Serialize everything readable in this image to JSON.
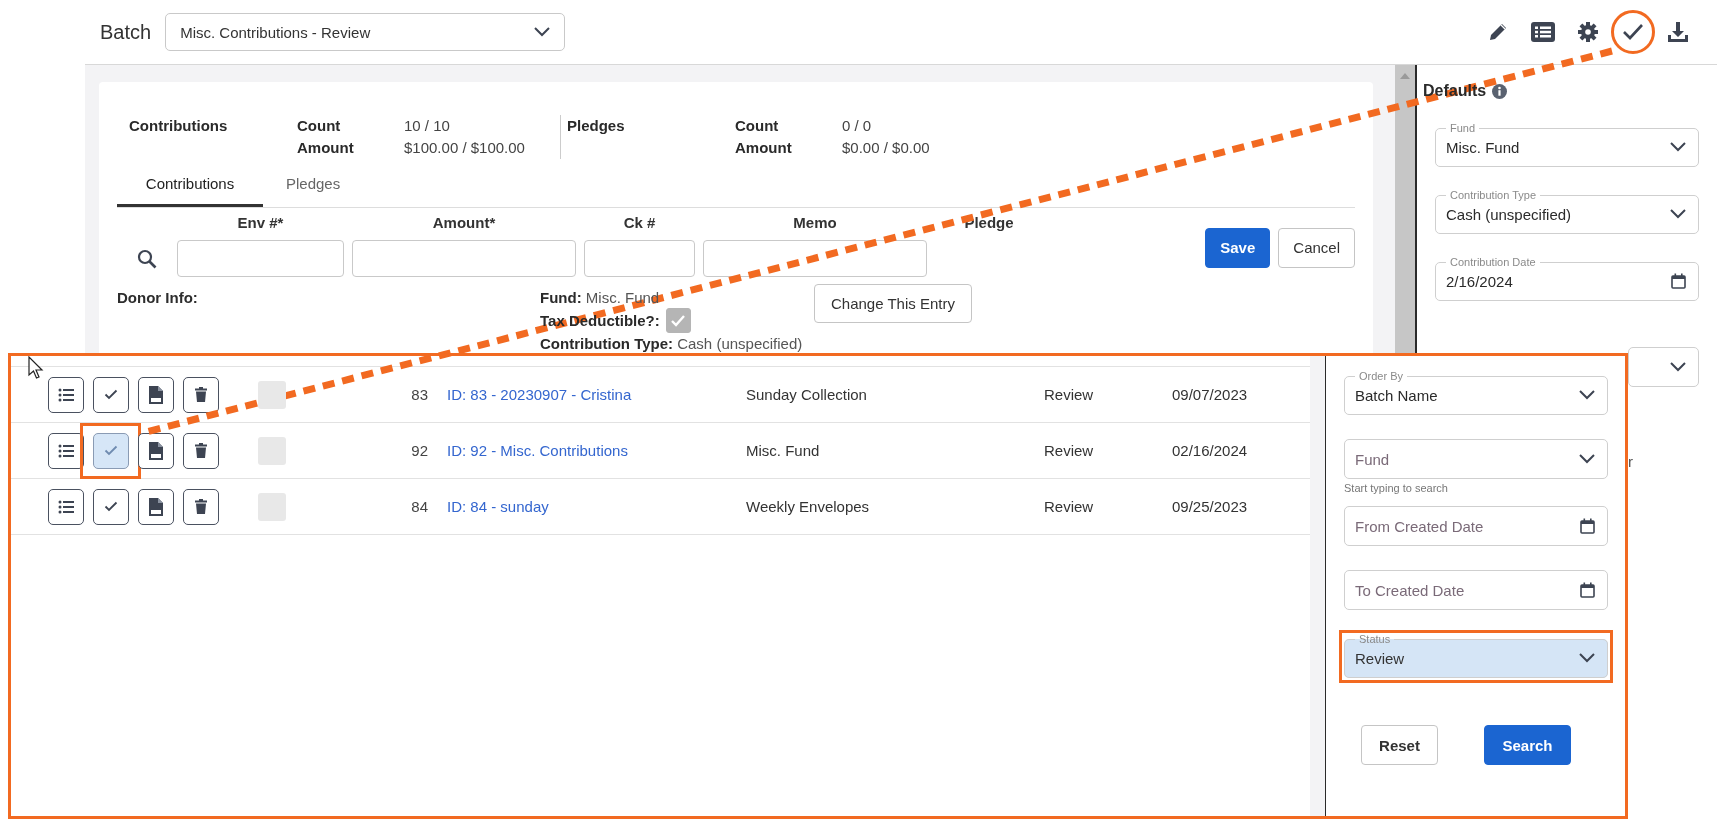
{
  "header": {
    "title": "Batch",
    "batch_select": "Misc. Contributions - Review",
    "toolbar": [
      {
        "kind": "edit",
        "annotated": false
      },
      {
        "kind": "list",
        "annotated": false
      },
      {
        "kind": "settings",
        "annotated": false
      },
      {
        "kind": "approve",
        "annotated": true
      },
      {
        "kind": "download",
        "annotated": false
      }
    ]
  },
  "summary": [
    {
      "label": "Contributions",
      "count_label": "Count",
      "count": "10 / 10",
      "amount_label": "Amount",
      "amount": "$100.00 / $100.00"
    },
    {
      "label": "Pledges",
      "count_label": "Count",
      "count": "0 / 0",
      "amount_label": "Amount",
      "amount": "$0.00 / $0.00"
    }
  ],
  "tabs": [
    {
      "label": "Contributions",
      "selected": true
    },
    {
      "label": "Pledges",
      "selected": false
    }
  ],
  "entry_form": {
    "columns": [
      "Env #*",
      "Amount*",
      "Ck #",
      "Memo",
      "Pledge"
    ],
    "save": "Save",
    "cancel": "Cancel",
    "donor_info": "Donor Info:",
    "fund": {
      "label": "Fund:",
      "value": "Misc. Fund"
    },
    "tax_deductible": {
      "label": "Tax Deductible?:",
      "checked": true
    },
    "contribution_type": {
      "label": "Contribution Type:",
      "value": "Cash (unspecified)"
    },
    "change_button": "Change This Entry"
  },
  "defaults": {
    "title": "Defaults",
    "fields": [
      {
        "kind": "select",
        "label": "Fund",
        "value": "Misc. Fund"
      },
      {
        "kind": "select",
        "label": "Contribution Type",
        "value": "Cash (unspecified)"
      },
      {
        "kind": "date",
        "label": "Contribution Date",
        "value": "2/16/2024"
      },
      {
        "kind": "select"
      }
    ],
    "partial_text": "r"
  },
  "inset": {
    "rows": [
      {
        "checked": false,
        "number": "83",
        "batch": "ID: 83 - 20230907 - Cristina",
        "fund": "Sunday Collection",
        "status": "Review",
        "date": "09/07/2023",
        "approve_annotated": false
      },
      {
        "checked": false,
        "number": "92",
        "batch": "ID: 92 - Misc. Contributions",
        "fund": "Misc. Fund",
        "status": "Review",
        "date": "02/16/2024",
        "approve_annotated": true
      },
      {
        "checked": false,
        "number": "84",
        "batch": "ID: 84 - sunday",
        "fund": "Weekly Envelopes",
        "status": "Review",
        "date": "09/25/2023",
        "approve_annotated": false
      }
    ],
    "filters": [
      {
        "kind": "select",
        "label": "Order By",
        "value": "Batch Name",
        "annotated": false
      },
      {
        "kind": "select",
        "placeholder": "Fund",
        "hint": "Start typing to search",
        "annotated": false
      },
      {
        "kind": "date",
        "placeholder": "From Created Date",
        "annotated": false
      },
      {
        "kind": "date",
        "placeholder": "To Created Date",
        "annotated": false
      },
      {
        "kind": "select",
        "label": "Status",
        "value": "Review",
        "annotated": true
      }
    ],
    "reset": "Reset",
    "search": "Search"
  }
}
